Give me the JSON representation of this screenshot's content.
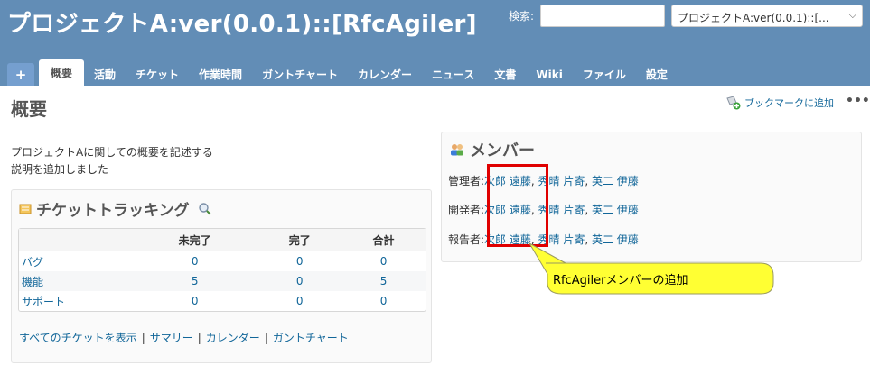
{
  "header": {
    "project_title": "プロジェクトA:ver(0.0.1)::[RfcAgiler]",
    "search_label": "検索:",
    "search_value": "",
    "project_jump": "プロジェクトA:ver(0.0.1)::[..."
  },
  "tabs": [
    {
      "label": "+"
    },
    {
      "label": "概要"
    },
    {
      "label": "活動"
    },
    {
      "label": "チケット"
    },
    {
      "label": "作業時間"
    },
    {
      "label": "ガントチャート"
    },
    {
      "label": "カレンダー"
    },
    {
      "label": "ニュース"
    },
    {
      "label": "文書"
    },
    {
      "label": "Wiki"
    },
    {
      "label": "ファイル"
    },
    {
      "label": "設定"
    }
  ],
  "page": {
    "title": "概要",
    "bookmark_label": "ブックマークに追加",
    "more": "•••",
    "description": [
      "プロジェクトAに関しての概要を記述する",
      "説明を追加しました"
    ]
  },
  "issues": {
    "title": "チケットトラッキング",
    "columns": [
      "",
      "未完了",
      "完了",
      "合計"
    ],
    "rows": [
      {
        "tracker": "バグ",
        "open": "0",
        "closed": "0",
        "total": "0"
      },
      {
        "tracker": "機能",
        "open": "5",
        "closed": "0",
        "total": "5"
      },
      {
        "tracker": "サポート",
        "open": "0",
        "closed": "0",
        "total": "0"
      }
    ],
    "links": [
      "すべてのチケットを表示",
      "サマリー",
      "カレンダー",
      "ガントチャート"
    ]
  },
  "members": {
    "title": "メンバー",
    "roles": [
      {
        "role": "管理者:",
        "users": [
          "次郎 遠藤",
          "秀晴 片寄",
          "英二 伊藤"
        ]
      },
      {
        "role": "開発者:",
        "users": [
          "次郎 遠藤",
          "秀晴 片寄",
          "英二 伊藤"
        ]
      },
      {
        "role": "報告者:",
        "users": [
          "次郎 遠藤",
          "秀晴 片寄",
          "英二 伊藤"
        ]
      }
    ]
  },
  "callout": {
    "text": "RfcAgilerメンバーの追加"
  },
  "colors": {
    "header_bg": "#628db6",
    "link": "#116699",
    "highlight": "#e00000",
    "callout_fill": "#ffff33"
  }
}
